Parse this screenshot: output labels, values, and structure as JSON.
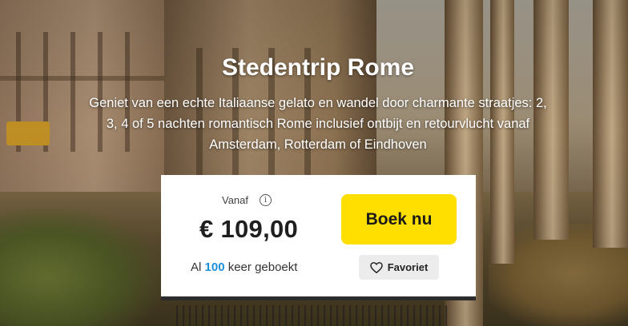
{
  "hero": {
    "title": "Stedentrip Rome",
    "subtitle": "Geniet van een echte Italiaanse gelato en wandel door charmante straatjes: 2, 3, 4 of 5 nachten romantisch Rome inclusief ontbijt en retourvlucht vanaf Amsterdam, Rotterdam of Eindhoven"
  },
  "card": {
    "from_label": "Vanaf",
    "info_icon": "info-icon",
    "price": "€ 109,00",
    "booked_prefix": "Al",
    "booked_count": "100",
    "booked_suffix": "keer geboekt",
    "book_button": "Boek nu",
    "favorite_button": "Favoriet",
    "favorite_icon": "heart-icon"
  },
  "colors": {
    "book_button_bg": "#ffdf00",
    "booked_count": "#1d8fd8",
    "favorite_bg": "#ececec"
  }
}
